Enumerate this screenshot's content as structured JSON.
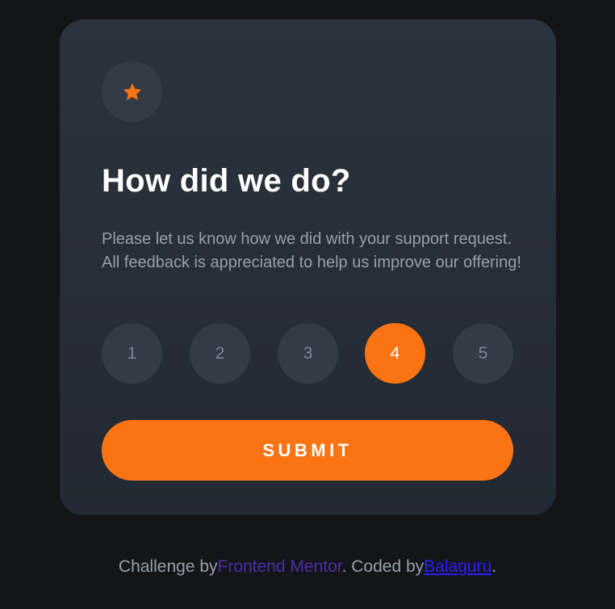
{
  "card": {
    "title": "How did we do?",
    "description": "Please let us know how we did with your support request. All feedback is appreciated to help us improve our offering!",
    "icon": "star-icon",
    "ratings": [
      {
        "label": "1",
        "selected": false
      },
      {
        "label": "2",
        "selected": false
      },
      {
        "label": "3",
        "selected": false
      },
      {
        "label": "4",
        "selected": true
      },
      {
        "label": "5",
        "selected": false
      }
    ],
    "selected_rating": "4",
    "submit_label": "SUBMIT"
  },
  "footer": {
    "prefix": "Challenge by",
    "challenge_link": "Frontend Mentor",
    "middle": ". Coded by",
    "author_link": "Balaguru",
    "suffix": "."
  },
  "colors": {
    "accent": "#fb7413",
    "background": "#131518",
    "card": "#262e38",
    "muted_text": "#969fab"
  }
}
